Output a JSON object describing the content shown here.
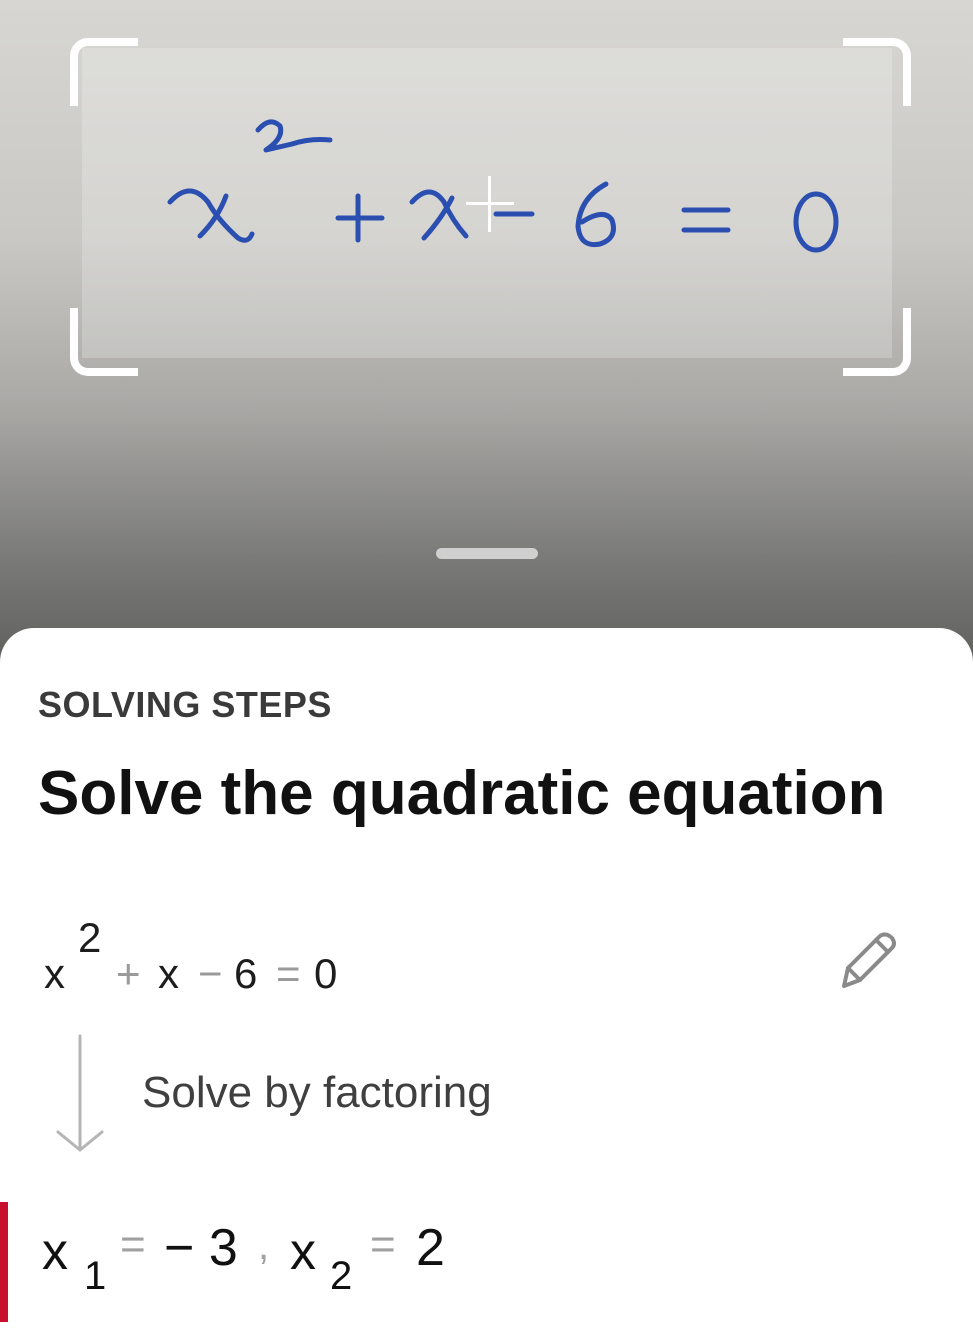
{
  "camera": {
    "scanned_equation": {
      "base": "x",
      "exponent": "2",
      "rest": "+x-6 = 0"
    }
  },
  "colors": {
    "accent": "#c8102e",
    "ink": "#2a4fb0",
    "title": "#111111"
  },
  "sheet": {
    "section_label": "SOLVING STEPS",
    "title": "Solve the quadratic equation",
    "equation": {
      "base": "x",
      "exponent": "2",
      "plus": "+",
      "x": "x",
      "minus": "−",
      "six": "6",
      "equals": "=",
      "zero": "0"
    },
    "step_label": "Solve by factoring",
    "result": {
      "x1": "x",
      "x1_sub": "1",
      "eq1": "=",
      "val1": "− 3",
      "comma": ",",
      "x2": "x",
      "x2_sub": "2",
      "eq2": "=",
      "val2": "2"
    },
    "icons": {
      "edit": "pencil-icon",
      "arrow": "arrow-down-icon"
    }
  }
}
